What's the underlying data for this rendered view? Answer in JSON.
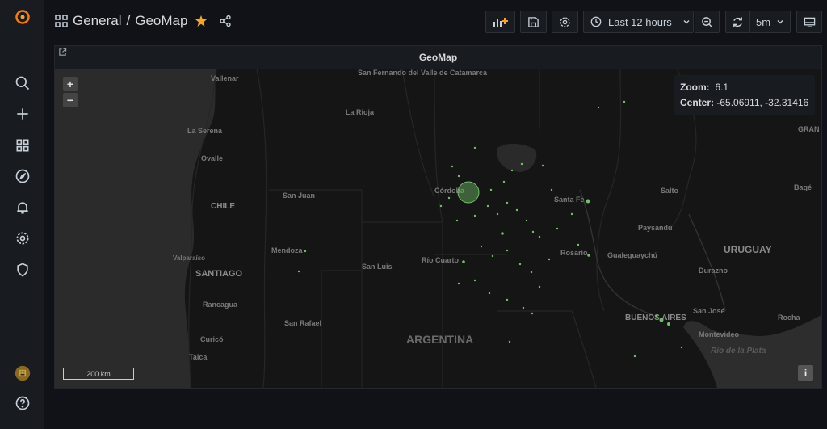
{
  "breadcrumb": {
    "folder": "General",
    "separator": "/",
    "dashboard": "GeoMap"
  },
  "toolbar": {
    "time_range": "Last 12 hours",
    "refresh_interval": "5m"
  },
  "panel": {
    "title": "GeoMap"
  },
  "map": {
    "zoom_label": "Zoom:",
    "zoom_value": "6.1",
    "center_label": "Center:",
    "center_value": "-65.06911, -32.31416",
    "zoom_in": "+",
    "zoom_out": "−",
    "scale_label": "200 km",
    "attribution": "i",
    "places": [
      "Vallenar",
      "San Fernando del Valle de Catamarca",
      "La Rioja",
      "La Serena",
      "Ovalle",
      "CHILE",
      "San Juan",
      "Córdoba",
      "Santa Fe",
      "Salto",
      "Bagé",
      "Paysandú",
      "Mendoza",
      "San Luis",
      "Río Cuarto",
      "Rosario",
      "Gualeguaychú",
      "URUGUAY",
      "Valparaíso",
      "SANTIAGO",
      "Durazno",
      "Rancagua",
      "San Rafael",
      "San José",
      "BUENOS AIRES",
      "Rocha",
      "Curicó",
      "ARGENTINA",
      "Montevideo",
      "Río de la Plata",
      "Talca",
      "GRAN"
    ]
  },
  "colors": {
    "accent": "#ff7a00",
    "marker": "#73bf69",
    "star": "#f5a623"
  },
  "icons": [
    "grafana-logo-icon",
    "search-icon",
    "plus-icon",
    "dashboards-icon",
    "explore-icon",
    "alert-bell-icon",
    "gear-icon",
    "shield-icon",
    "avatar",
    "help-icon",
    "grid-icon",
    "star-icon",
    "share-icon",
    "add-panel-icon",
    "save-icon",
    "settings-icon",
    "clock-icon",
    "chevron-down-icon",
    "zoom-out-icon",
    "refresh-icon",
    "tv-icon",
    "external-link-icon"
  ]
}
